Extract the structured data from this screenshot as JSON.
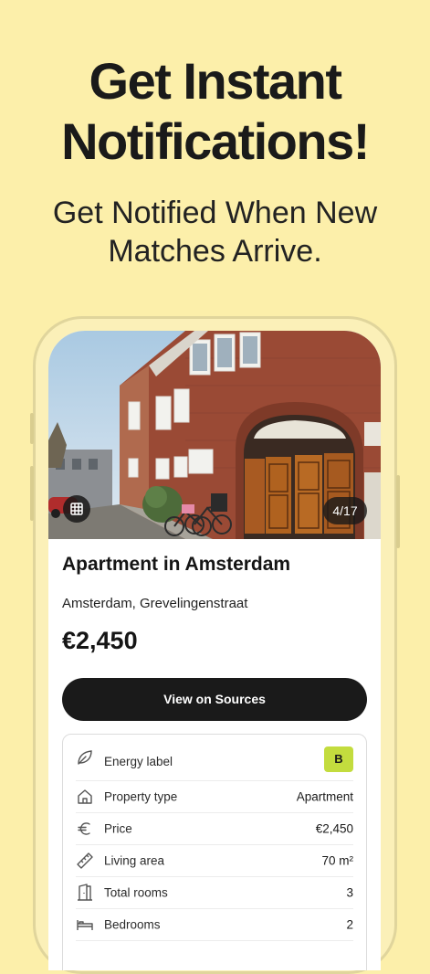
{
  "hero": {
    "headline_line1": "Get Instant",
    "headline_line2": "Notifications!",
    "subhead_line1": "Get Notified When New",
    "subhead_line2": "Matches Arrive."
  },
  "listing": {
    "photo_counter": "4/17",
    "title": "Apartment in Amsterdam",
    "location": "Amsterdam, Grevelingenstraat",
    "price": "€2,450",
    "cta_label": "View on Sources"
  },
  "details": {
    "rows": [
      {
        "icon": "leaf-icon",
        "label": "Energy label",
        "value": "B"
      },
      {
        "icon": "house-icon",
        "label": "Property type",
        "value": "Apartment"
      },
      {
        "icon": "euro-icon",
        "label": "Price",
        "value": "€2,450"
      },
      {
        "icon": "ruler-icon",
        "label": "Living area",
        "value": "70 m²"
      },
      {
        "icon": "door-icon",
        "label": "Total rooms",
        "value": "3"
      },
      {
        "icon": "bed-icon",
        "label": "Bedrooms",
        "value": "2"
      }
    ]
  },
  "colors": {
    "background": "#fcefaa",
    "button": "#1a1a1a",
    "energy_badge": "#c3dc3e"
  }
}
